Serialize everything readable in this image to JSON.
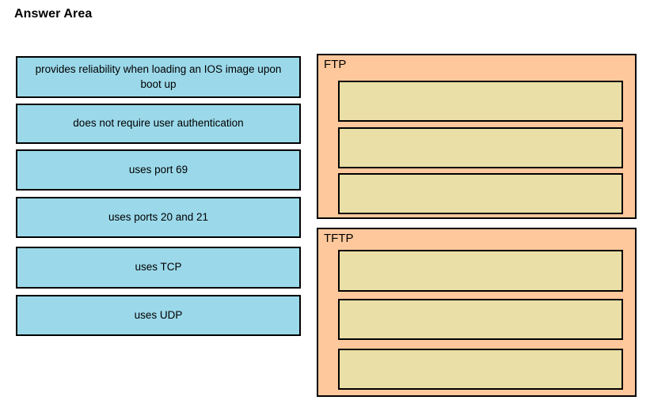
{
  "page": {
    "title": "Answer Area"
  },
  "options": {
    "items": [
      {
        "label": "provides reliability when loading an IOS image upon boot up"
      },
      {
        "label": "does not require user authentication"
      },
      {
        "label": "uses port 69"
      },
      {
        "label": "uses ports 20 and 21"
      },
      {
        "label": "uses TCP"
      },
      {
        "label": "uses UDP"
      }
    ]
  },
  "categories": [
    {
      "label": "FTP",
      "slots": [
        {
          "label": ""
        },
        {
          "label": ""
        },
        {
          "label": ""
        }
      ]
    },
    {
      "label": "TFTP",
      "slots": [
        {
          "label": ""
        },
        {
          "label": ""
        },
        {
          "label": ""
        }
      ]
    }
  ],
  "colors": {
    "option_fill": "#9BD9EA",
    "category_fill": "#FFC89C",
    "slot_fill": "#EADFA6",
    "border": "#000000",
    "background": "#FFFFFF"
  }
}
